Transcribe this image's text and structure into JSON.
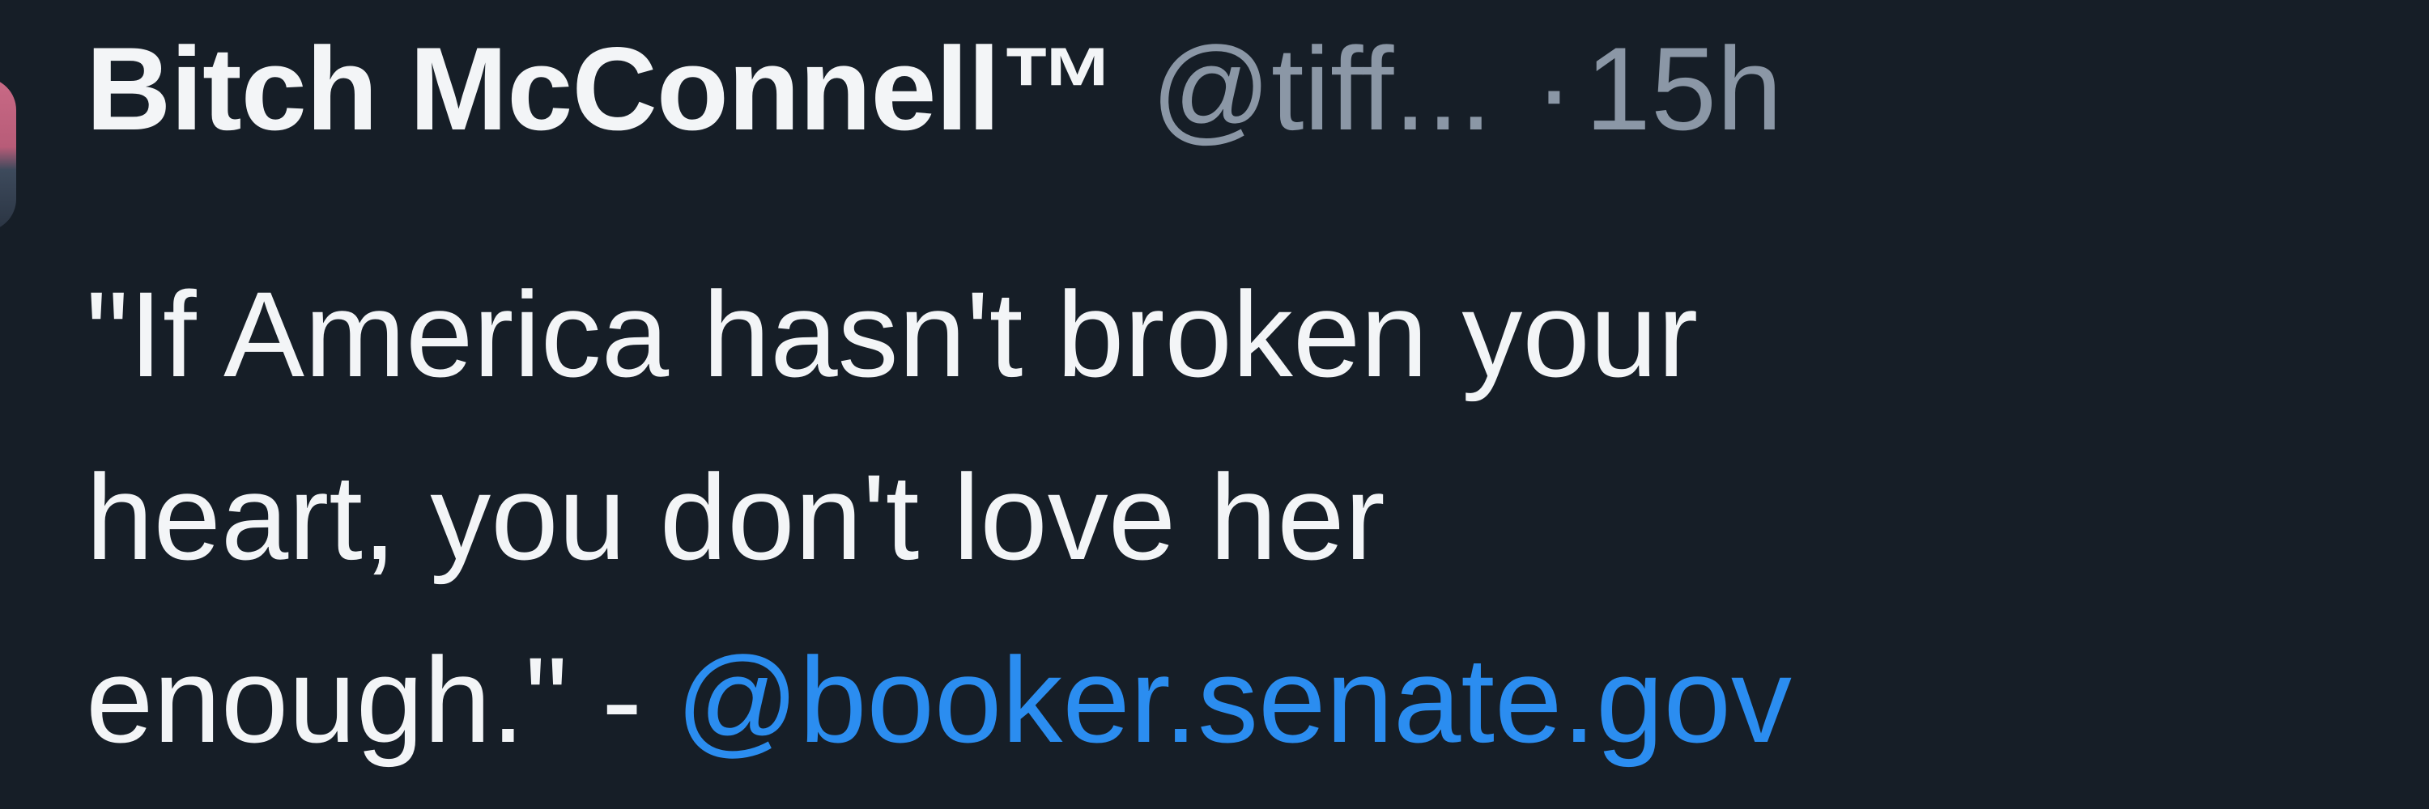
{
  "post": {
    "display_name": "Bitch McConnell™",
    "handle": "@tiff...",
    "separator": "·",
    "time": "15h",
    "text_lines": [
      "\"If America hasn't broken your",
      "heart, you don't love her",
      "enough.\" - "
    ],
    "mention": "@booker.senate.gov"
  },
  "colors": {
    "background": "#161e27",
    "text": "#f3f5f7",
    "muted": "#8b97a6",
    "link": "#2b8df0"
  }
}
